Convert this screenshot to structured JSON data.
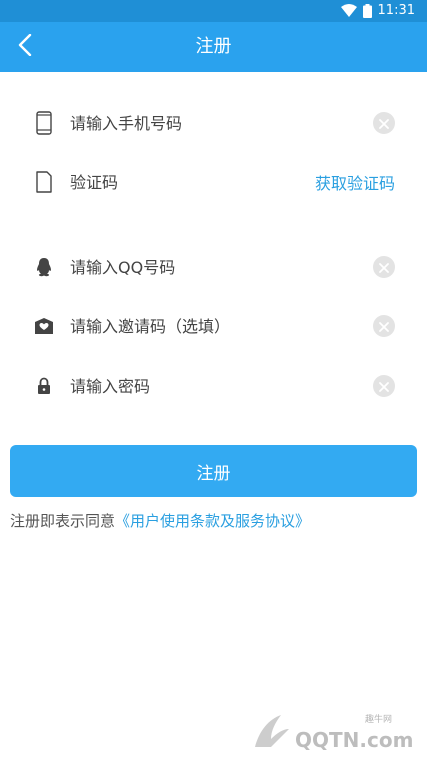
{
  "status_bar": {
    "time": "11:31"
  },
  "app_bar": {
    "title": "注册"
  },
  "form": {
    "phone_placeholder": "请输入手机号码",
    "code_placeholder": "验证码",
    "get_code_label": "获取验证码",
    "qq_placeholder": "请输入QQ号码",
    "invite_placeholder": "请输入邀请码（选填）",
    "password_placeholder": "请输入密码"
  },
  "submit": {
    "label": "注册"
  },
  "agreement": {
    "prefix": "注册即表示同意",
    "link": "《用户使用条款及服务协议》"
  },
  "watermark": {
    "small": "趣牛网",
    "brand": "QQTN.com"
  },
  "colors": {
    "primary": "#2aa2ee",
    "button": "#33aaf2",
    "link": "#2a9fe0",
    "status_bar": "#1f8fd6"
  }
}
